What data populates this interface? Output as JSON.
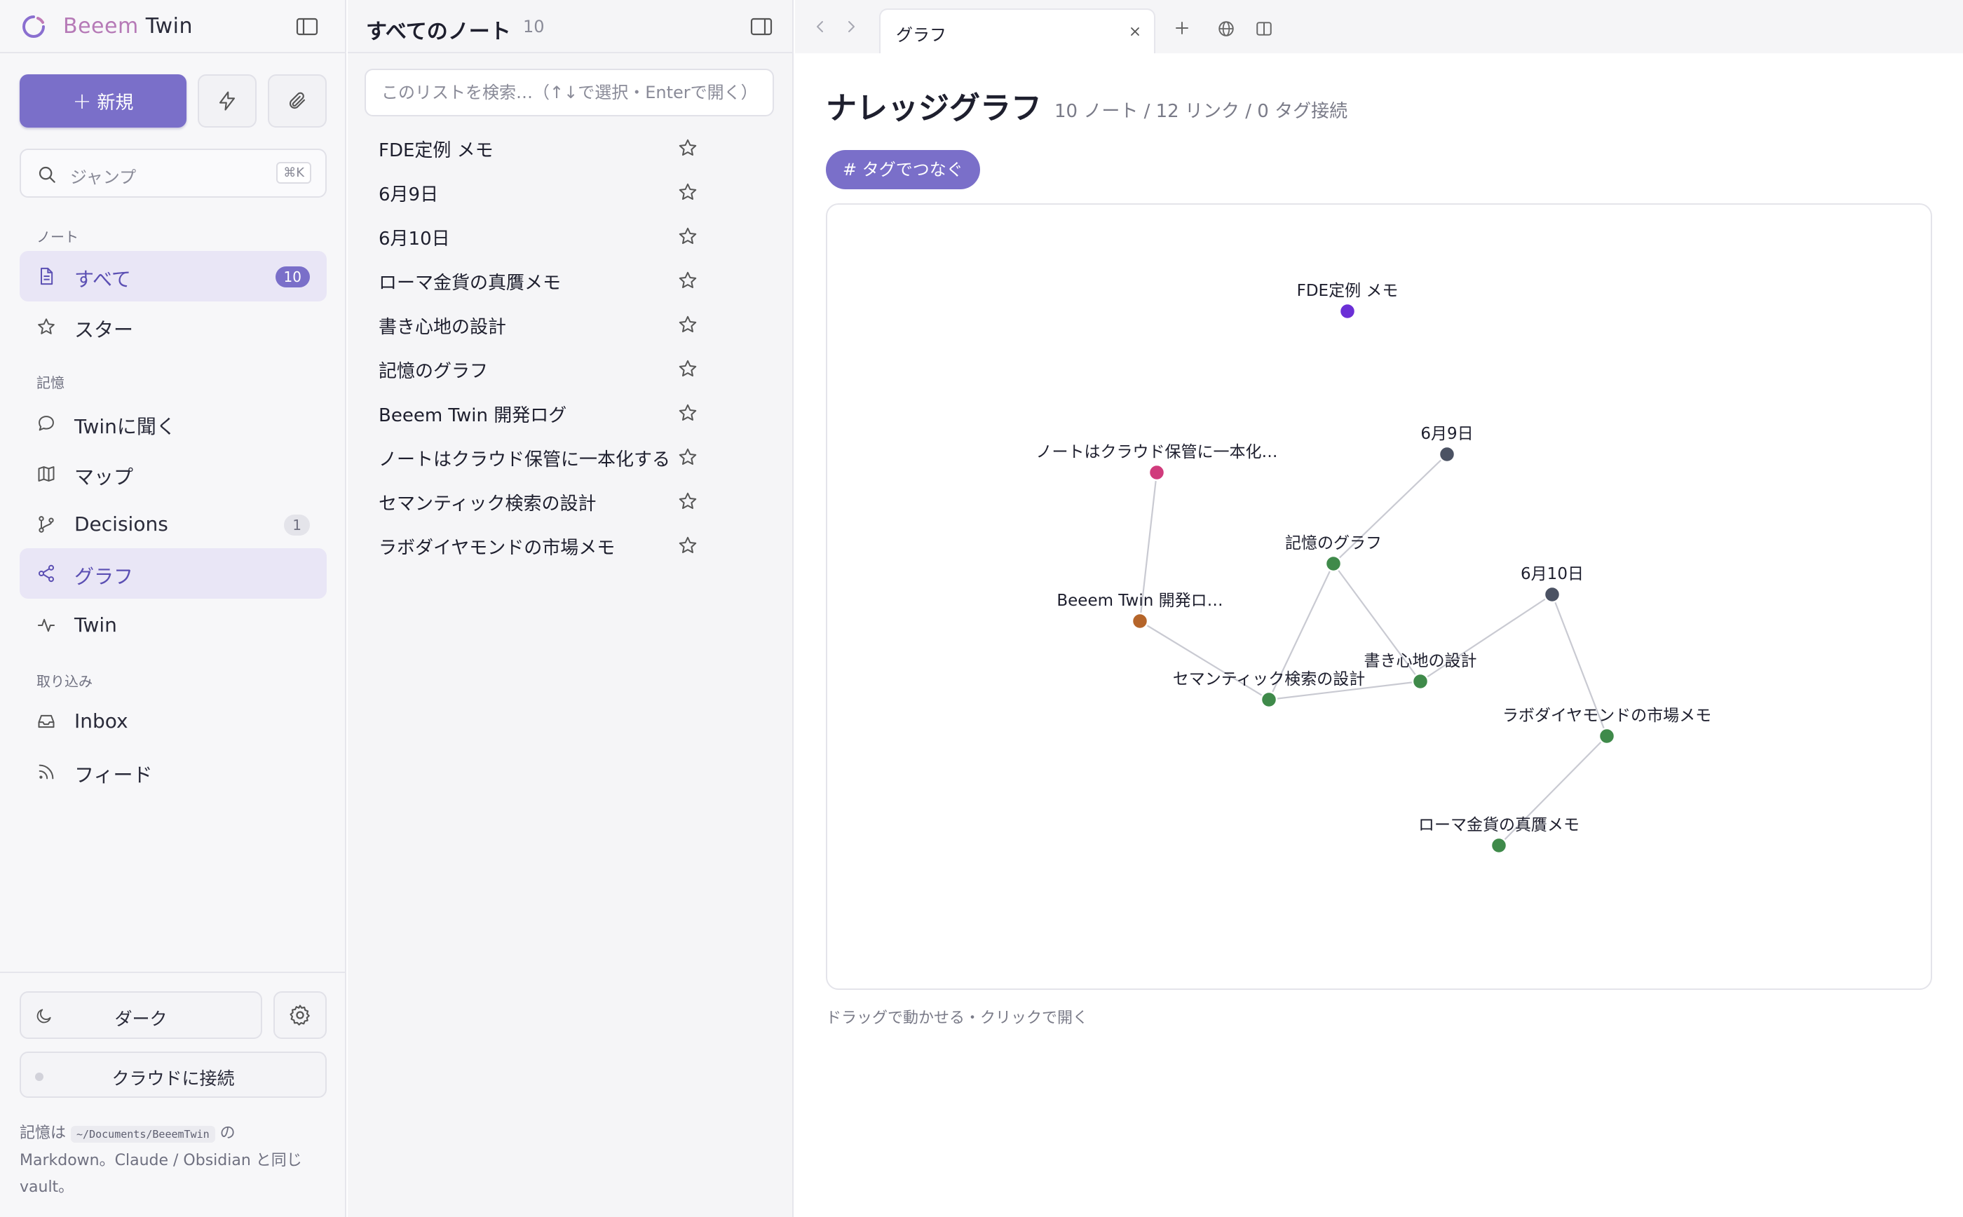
{
  "app": {
    "name_part1": "Beeem",
    "name_part2": "Twin"
  },
  "sidebar": {
    "new_label": "新規",
    "jump_placeholder": "ジャンプ",
    "jump_shortcut": "⌘K",
    "sections": {
      "notes": "ノート",
      "memory": "記憶",
      "import": "取り込み"
    },
    "items": [
      {
        "label": "すべて",
        "icon": "document-icon",
        "badge": "10",
        "active": true
      },
      {
        "label": "スター",
        "icon": "star-icon"
      },
      {
        "label": "Twinに聞く",
        "icon": "chat-bubble-icon"
      },
      {
        "label": "マップ",
        "icon": "map-icon"
      },
      {
        "label": "Decisions",
        "icon": "branch-icon",
        "badge": "1"
      },
      {
        "label": "グラフ",
        "icon": "share-nodes-icon",
        "active": true
      },
      {
        "label": "Twin",
        "icon": "pulse-icon"
      },
      {
        "label": "Inbox",
        "icon": "inbox-icon"
      },
      {
        "label": "フィード",
        "icon": "rss-icon"
      }
    ],
    "dark_label": "ダーク",
    "cloud_label": "クラウドに接続",
    "vault_prefix": "記憶は",
    "vault_path": "~/Documents/BeeemTwin",
    "vault_suffix": "の Markdown。Claude / Obsidian と同じ vault。"
  },
  "notelist": {
    "title": "すべてのノート",
    "count": "10",
    "search_placeholder": "このリストを検索…（↑↓で選択・Enterで開く）",
    "items": [
      "FDE定例 メモ",
      "6月9日",
      "6月10日",
      "ローマ金貨の真贋メモ",
      "書き心地の設計",
      "記憶のグラフ",
      "Beeem Twin 開発ログ",
      "ノートはクラウド保管に一本化する",
      "セマンティック検索の設計",
      "ラボダイヤモンドの市場メモ"
    ]
  },
  "tabbar": {
    "tab_label": "グラフ"
  },
  "main": {
    "title": "ナレッジグラフ",
    "stats": "10 ノート / 12 リンク / 0 タグ接続",
    "tag_button": "# タグでつなぐ",
    "hint": "ドラッグで動かせる・クリックで開く"
  },
  "graph": {
    "nodes": [
      {
        "id": "fde",
        "label": "FDE定例 メモ",
        "color": "#6b2fd6"
      },
      {
        "id": "june9",
        "label": "6月9日",
        "color": "#4b5263"
      },
      {
        "id": "cloud",
        "label": "ノートはクラウド保管に一本化…",
        "color": "#d03b7c"
      },
      {
        "id": "memgraph",
        "label": "記憶のグラフ",
        "color": "#3f8a4a"
      },
      {
        "id": "june10",
        "label": "6月10日",
        "color": "#4b5263"
      },
      {
        "id": "devlog",
        "label": "Beeem Twin 開発ロ…",
        "color": "#b5652a"
      },
      {
        "id": "writing",
        "label": "書き心地の設計",
        "color": "#3f8a4a"
      },
      {
        "id": "semantic",
        "label": "セマンティック検索の設計",
        "color": "#3f8a4a"
      },
      {
        "id": "diamond",
        "label": "ラボダイヤモンドの市場メモ",
        "color": "#3f8a4a"
      },
      {
        "id": "roma",
        "label": "ローマ金貨の真贋メモ",
        "color": "#3f8a4a"
      }
    ],
    "links": [
      [
        "cloud",
        "devlog"
      ],
      [
        "june9",
        "memgraph"
      ],
      [
        "memgraph",
        "semantic"
      ],
      [
        "memgraph",
        "writing"
      ],
      [
        "devlog",
        "semantic"
      ],
      [
        "semantic",
        "writing"
      ],
      [
        "writing",
        "june10"
      ],
      [
        "june10",
        "diamond"
      ],
      [
        "diamond",
        "roma"
      ]
    ]
  }
}
